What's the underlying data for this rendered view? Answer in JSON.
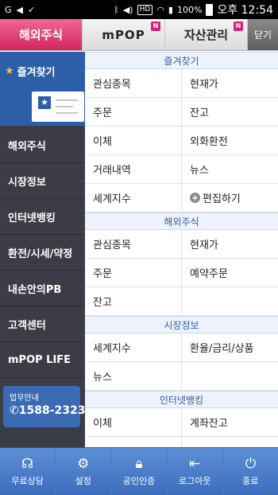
{
  "statusbar": {
    "battery": "100%",
    "time": "오후 12:54",
    "hd": "HD"
  },
  "tabs": [
    {
      "label": "해외주식"
    },
    {
      "label": "mPOP",
      "badge": "N"
    },
    {
      "label": "자산관리",
      "badge": "N"
    },
    {
      "label": "닫기"
    }
  ],
  "sidebar": {
    "favorites": "즐겨찾기",
    "items": [
      {
        "label": "해외주식"
      },
      {
        "label": "시장정보"
      },
      {
        "label": "인터넷뱅킹"
      },
      {
        "label": "환전/시세/약정"
      },
      {
        "label": "내손안의PB"
      },
      {
        "label": "고객센터"
      },
      {
        "label": "mPOP LIFE"
      }
    ],
    "support": {
      "label": "업무안내",
      "phone": "1588-2323"
    }
  },
  "sections": [
    {
      "title": "즐겨찾기",
      "rows": [
        [
          "관심종목",
          "현재가"
        ],
        [
          "주문",
          "잔고"
        ],
        [
          "이체",
          "외화환전"
        ],
        [
          "거래내역",
          "뉴스"
        ],
        [
          "세계지수",
          "편집하기"
        ]
      ]
    },
    {
      "title": "해외주식",
      "rows": [
        [
          "관심종목",
          "현재가"
        ],
        [
          "주문",
          "예약주문"
        ],
        [
          "잔고",
          ""
        ]
      ]
    },
    {
      "title": "시장정보",
      "rows": [
        [
          "세계지수",
          "환율/금리/상품"
        ],
        [
          "뉴스",
          ""
        ]
      ]
    },
    {
      "title": "인터넷뱅킹",
      "rows": [
        [
          "이체",
          "계좌잔고"
        ],
        [
          "",
          ""
        ]
      ]
    }
  ],
  "bottombar": [
    {
      "label": "무료상담",
      "icon": "headset-icon"
    },
    {
      "label": "설정",
      "icon": "gear-icon"
    },
    {
      "label": "공인인증",
      "icon": "lock-icon"
    },
    {
      "label": "로그아웃",
      "icon": "logout-icon"
    },
    {
      "label": "종료",
      "icon": "power-icon"
    }
  ]
}
